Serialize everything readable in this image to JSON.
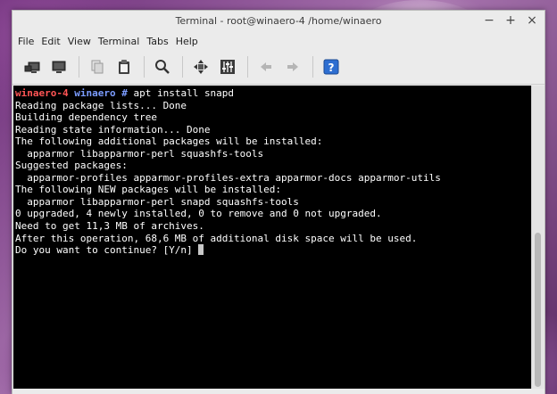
{
  "window": {
    "title": "Terminal - root@winaero-4 /home/winaero",
    "controls": {
      "minimize": "−",
      "maximize": "+",
      "close": "×"
    }
  },
  "menu": [
    "File",
    "Edit",
    "View",
    "Terminal",
    "Tabs",
    "Help"
  ],
  "toolbar": {
    "buttons": [
      {
        "icon": "new-tab-icon"
      },
      {
        "icon": "new-window-icon"
      },
      {
        "icon": "copy-icon"
      },
      {
        "icon": "paste-icon"
      },
      {
        "icon": "search-icon"
      },
      {
        "icon": "fullscreen-icon"
      },
      {
        "icon": "settings-icon"
      },
      {
        "icon": "previous-tab-icon"
      },
      {
        "icon": "next-tab-icon"
      },
      {
        "icon": "help-icon",
        "label": "?"
      }
    ]
  },
  "terminal": {
    "prompt": {
      "host": "winaero-4",
      "dir": "winaero",
      "symbol": "#",
      "command": "apt install snapd"
    },
    "output": [
      "Reading package lists... Done",
      "Building dependency tree",
      "Reading state information... Done",
      "The following additional packages will be installed:",
      "  apparmor libapparmor-perl squashfs-tools",
      "Suggested packages:",
      "  apparmor-profiles apparmor-profiles-extra apparmor-docs apparmor-utils",
      "The following NEW packages will be installed:",
      "  apparmor libapparmor-perl snapd squashfs-tools",
      "0 upgraded, 4 newly installed, 0 to remove and 0 not upgraded.",
      "Need to get 11,3 MB of archives.",
      "After this operation, 68,6 MB of additional disk space will be used."
    ],
    "question": "Do you want to continue? [Y/n] "
  },
  "colors": {
    "terminal_bg": "#000000",
    "terminal_fg": "#ffffff",
    "prompt_host": "#ff5555",
    "prompt_dir": "#7b9cff",
    "help_blue": "#2d6ed1"
  }
}
